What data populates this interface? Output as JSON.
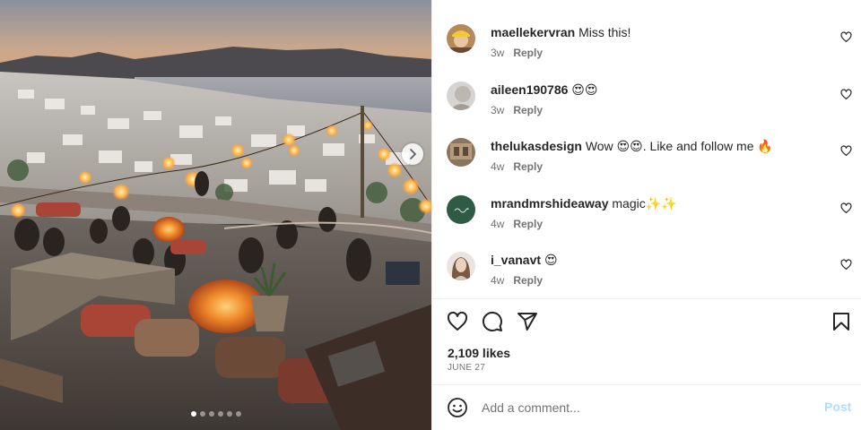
{
  "post": {
    "image_alt": "Rooftop bar at sunset overlooking a white village by the sea",
    "carousel_dots": 6,
    "carousel_active": 0
  },
  "comments": [
    {
      "username": "maellekervran",
      "text": "Miss this!",
      "age": "3w",
      "reply": "Reply",
      "avatar_icon": "avatar-yellow-cap"
    },
    {
      "username": "aileen190786",
      "text": "😍😍",
      "age": "3w",
      "reply": "Reply",
      "avatar_icon": "avatar-gray"
    },
    {
      "username": "thelukasdesign",
      "text": "Wow 😍😍. Like and follow me 🔥",
      "age": "4w",
      "reply": "Reply",
      "avatar_icon": "avatar-brown"
    },
    {
      "username": "mrandmrshideaway",
      "text": "magic✨✨",
      "age": "4w",
      "reply": "Reply",
      "avatar_icon": "avatar-green-logo"
    },
    {
      "username": "i_vanavt",
      "text": "😍",
      "age": "4w",
      "reply": "Reply",
      "avatar_icon": "avatar-woman"
    }
  ],
  "stats": {
    "likes": "2,109 likes",
    "date": "JUNE 27"
  },
  "composer": {
    "placeholder": "Add a comment...",
    "post_label": "Post"
  },
  "colors": {
    "text": "#262626",
    "muted": "#737373",
    "post_disabled": "#b3dbff",
    "divider": "#efefef"
  }
}
